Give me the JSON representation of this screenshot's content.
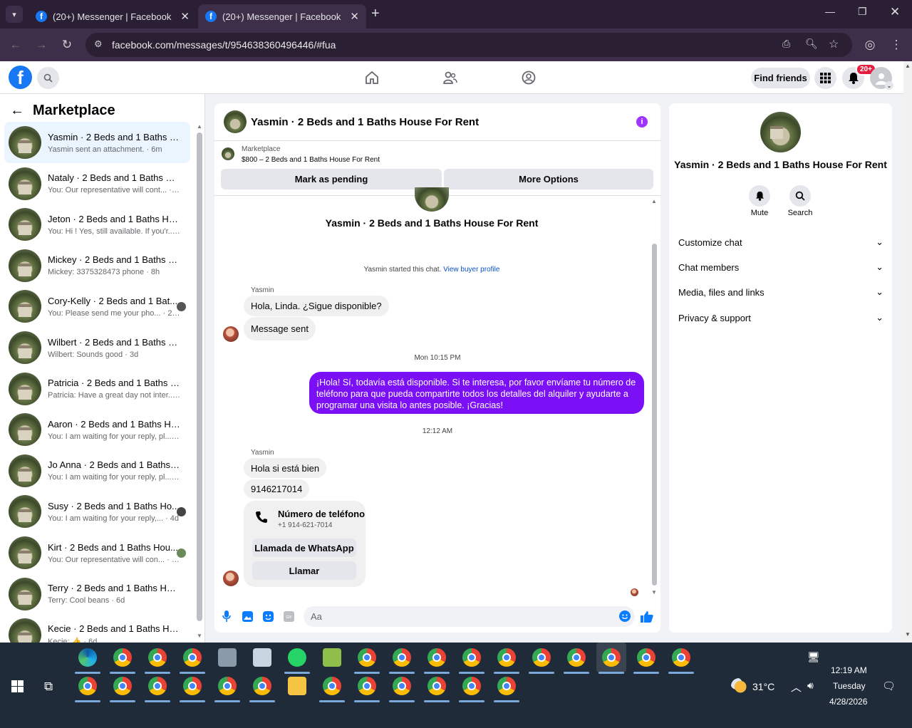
{
  "browser": {
    "tabs": [
      {
        "title": "(20+) Messenger | Facebook"
      },
      {
        "title": "(20+) Messenger | Facebook"
      }
    ],
    "url": "facebook.com/messages/t/954638360496446/#fua"
  },
  "header": {
    "find_friends": "Find friends",
    "notifications_badge": "20+"
  },
  "sidebar": {
    "title": "Marketplace",
    "conversations": [
      {
        "name": "Yasmin · 2 Beds and 1 Baths Ho...",
        "preview": "Yasmin sent an attachment. · 6m"
      },
      {
        "name": "Nataly · 2 Beds and 1 Baths Hou...",
        "preview": "You: Our representative will cont... · 20m"
      },
      {
        "name": "Jeton · 2 Beds and 1 Baths Hous...",
        "preview": "You: Hi ! Yes, still available. If you'r... · 2h"
      },
      {
        "name": "Mickey · 2 Beds and 1 Baths Ho...",
        "preview": "Mickey: 3375328473 phone · 8h"
      },
      {
        "name": "Cory-Kelly · 2 Beds and 1 Bat...",
        "preview": "You: Please send me your pho... · 23h"
      },
      {
        "name": "Wilbert · 2 Beds and 1 Baths Ho...",
        "preview": "Wilbert: Sounds good · 3d"
      },
      {
        "name": "Patricia · 2 Beds and 1 Baths Ho...",
        "preview": "Patricia: Have a great day not inter... · 3d"
      },
      {
        "name": "Aaron · 2 Beds and 1 Baths Hou...",
        "preview": "You: I am waiting for your reply, pl... · 4d"
      },
      {
        "name": "Jo Anna · 2 Beds and 1 Baths Ho...",
        "preview": "You: I am waiting for your reply, pl... · 4d"
      },
      {
        "name": "Susy · 2 Beds and 1 Baths Ho...",
        "preview": "You: I am waiting for your reply,... · 4d"
      },
      {
        "name": "Kirt · 2 Beds and 1 Baths Hou...",
        "preview": "You: Our representative will con... · 5d"
      },
      {
        "name": "Terry · 2 Beds and 1 Baths Hous...",
        "preview": "Terry: Cool beans · 6d"
      },
      {
        "name": "Kecie · 2 Beds and 1 Baths Hous...",
        "preview": "Kecie: 👍 · 6d"
      }
    ]
  },
  "chat": {
    "title": "Yasmin · 2 Beds and 1 Baths House For Rent",
    "marketplace_label": "Marketplace",
    "listing": "$800 – 2 Beds and 1 Baths House For Rent",
    "mark_pending": "Mark as pending",
    "more_options": "More Options",
    "intro_title": "Yasmin · 2 Beds and 1 Baths House For Rent",
    "started_text": "Yasmin started this chat.",
    "view_profile": "View buyer profile",
    "sender1": "Yasmin",
    "msg1": "Hola, Linda. ¿Sigue disponible?",
    "msg2": "Message sent",
    "time1": "Mon 10:15 PM",
    "outgoing": "¡Hola! Sí, todavía está disponible. Si te interesa, por favor envíame tu número de teléfono para que pueda compartirte todos los detalles del alquiler y ayudarte a programar una visita lo antes posible. ¡Gracias!",
    "time2": "12:12 AM",
    "sender2": "Yasmin",
    "msg3": "Hola si está bien",
    "msg4": "9146217014",
    "card_title": "Número de teléfono",
    "card_phone": "+1 914-621-7014",
    "card_whatsapp": "Llamada de WhatsApp",
    "card_call": "Llamar",
    "composer_placeholder": "Aa"
  },
  "details": {
    "title": "Yasmin · 2 Beds and 1 Baths House For Rent",
    "mute": "Mute",
    "search": "Search",
    "sections": [
      "Customize chat",
      "Chat members",
      "Media, files and links",
      "Privacy & support"
    ]
  },
  "taskbar": {
    "temperature": "31°C",
    "time": "12:19 AM",
    "day": "Tuesday",
    "date": "4/28/2026"
  },
  "colors": {
    "accent": "#7b0ff5",
    "fb_blue": "#1877f2",
    "badge": "#e41e3f"
  }
}
